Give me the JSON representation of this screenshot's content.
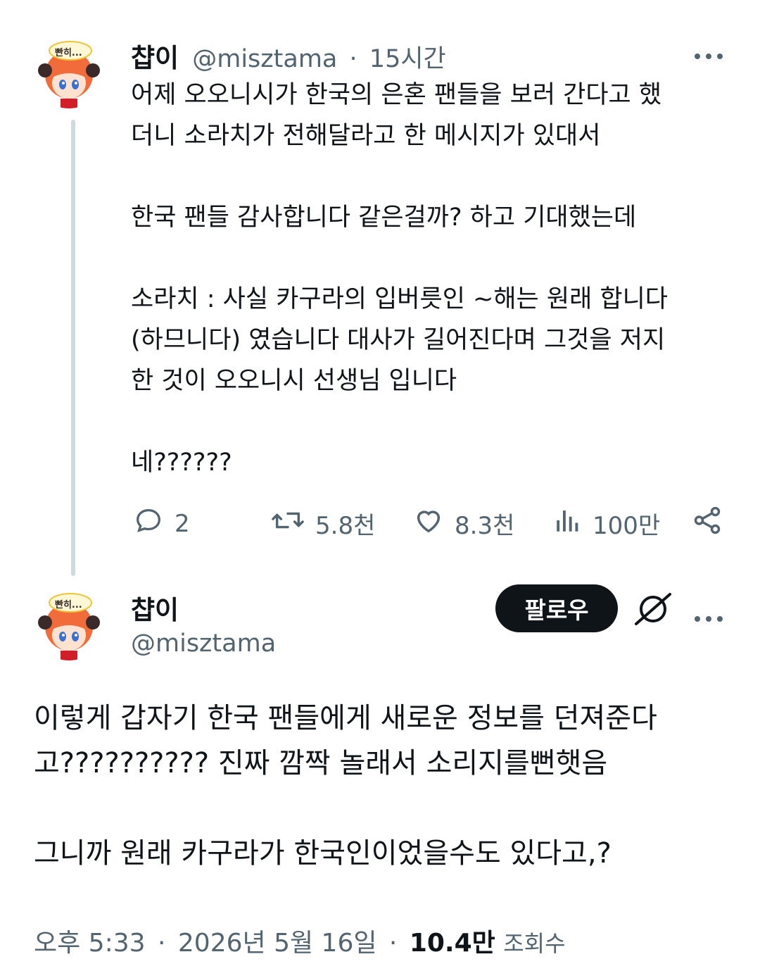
{
  "tweet1": {
    "avatar_badge": "빤히...",
    "name": "챱이",
    "handle": "@misztama",
    "dot": "·",
    "time": "15시간",
    "more_icon": "more-dots-icon",
    "body": "어제 오오니시가 한국의 은혼 팬들을 보러 간다고 했\n더니 소라치가 전해달라고 한 메시지가 있대서\n\n한국 팬들 감사합니다 같은걸까? 하고 기대했는데\n\n소라치 : 사실 카구라의 입버릇인 ~해는 원래 합니다\n(하므니다) 였습니다 대사가 길어진다며 그것을 저지\n한 것이 오오니시 선생님 입니다\n\n네??????",
    "actions": {
      "replies": "2",
      "retweets": "5.8천",
      "likes": "8.3천",
      "views": "100만"
    }
  },
  "tweet2": {
    "avatar_badge": "빤히...",
    "name": "챱이",
    "handle": "@misztama",
    "follow_label": "팔로우",
    "body": "이렇게 갑자기 한국 팬들에게 새로운 정보를 던져준다\n고?????????? 진짜 깜짝 놀래서 소리지를뻔햇음\n\n그니까 원래 카구라가 한국인이었을수도 있다고,?",
    "meta": {
      "time": "오후 5:33",
      "sep1": "·",
      "date": "2026년 5월 16일",
      "sep2": "·",
      "views_count": "10.4만",
      "views_label": "조회수"
    }
  },
  "colors": {
    "text": "#0f1419",
    "muted": "#536471",
    "thread_line": "#cfd9de",
    "avatar_hair": "#f26b3a",
    "follow_bg": "#0f1419"
  }
}
